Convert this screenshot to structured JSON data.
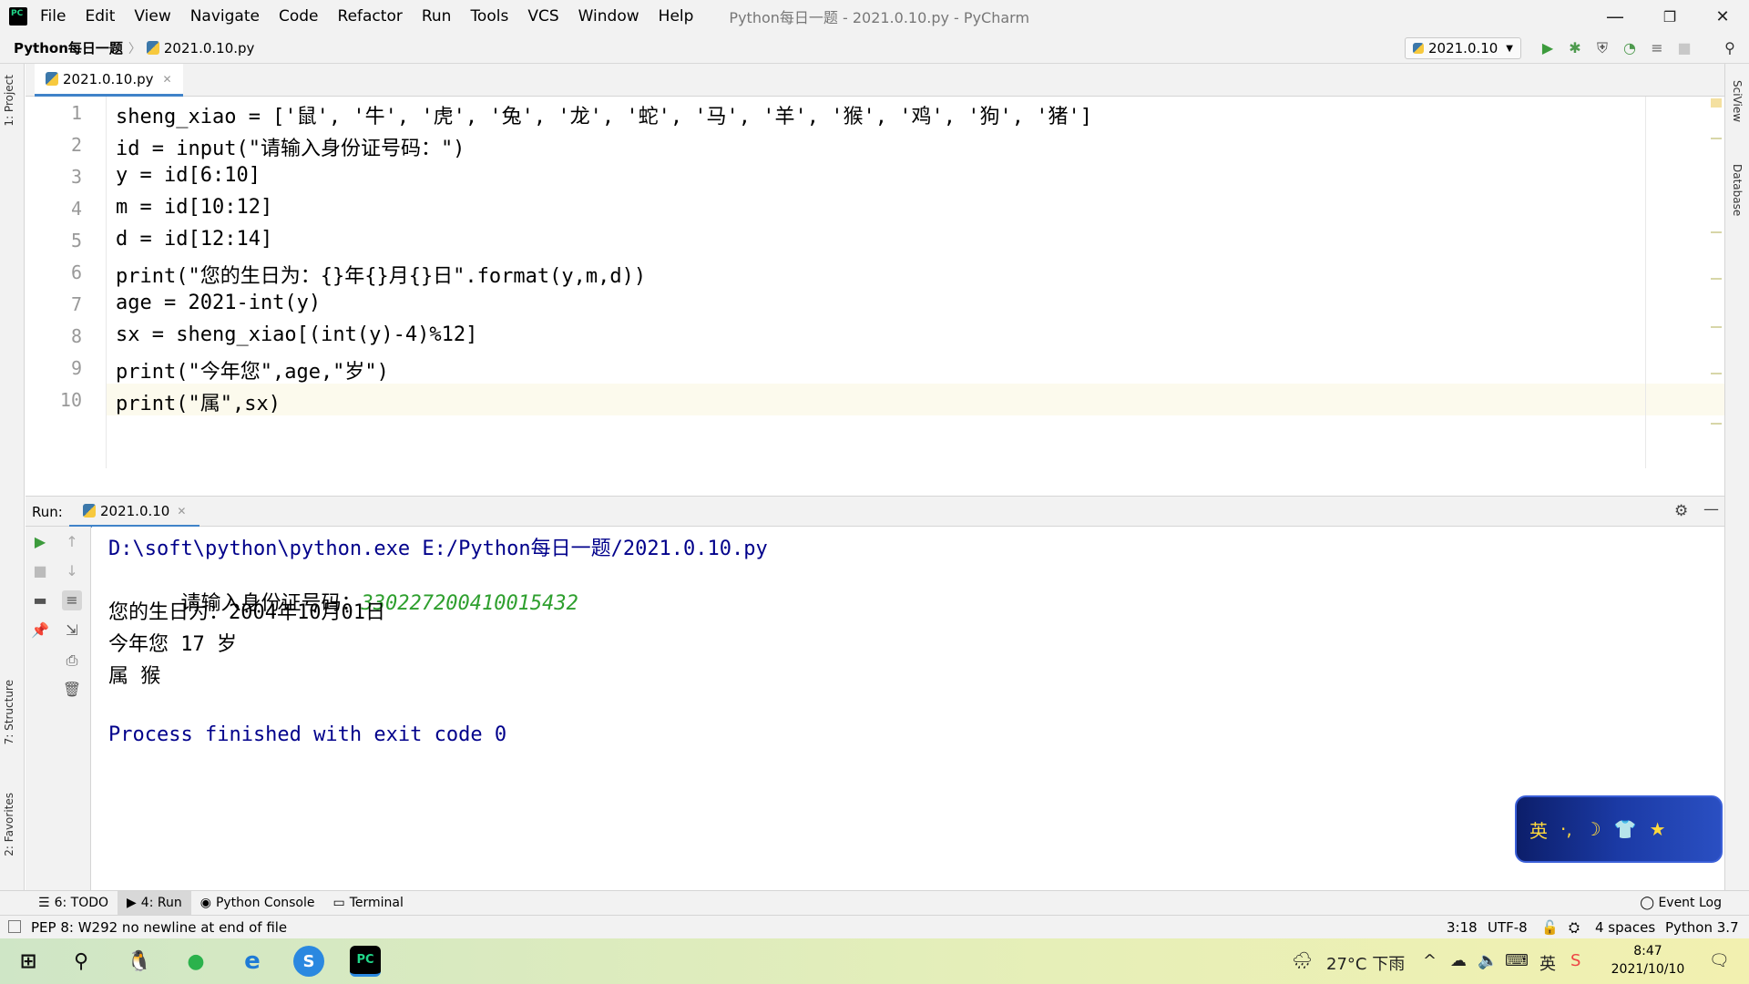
{
  "titlebar": {
    "menu": [
      "File",
      "Edit",
      "View",
      "Navigate",
      "Code",
      "Refactor",
      "Run",
      "Tools",
      "VCS",
      "Window",
      "Help"
    ],
    "title": "Python每日一题 - 2021.0.10.py - PyCharm",
    "minimize": "—",
    "restore": "❐",
    "close": "✕"
  },
  "navbar": {
    "project": "Python每日一题",
    "file": "2021.0.10.py",
    "run_config": "2021.0.10"
  },
  "sidebars": {
    "left": [
      "1: Project",
      "7: Structure",
      "2: Favorites"
    ],
    "right": [
      "SciView",
      "Database"
    ]
  },
  "editor": {
    "tab": "2021.0.10.py",
    "line_numbers": [
      "1",
      "2",
      "3",
      "4",
      "5",
      "6",
      "7",
      "8",
      "9",
      "10"
    ],
    "lines": [
      "sheng_xiao = ['鼠', '牛', '虎', '兔', '龙', '蛇', '马', '羊', '猴', '鸡', '狗', '猪']",
      "id = input(\"请输入身份证号码：\")",
      "y = id[6:10]",
      "m = id[10:12]",
      "d = id[12:14]",
      "print(\"您的生日为：{}年{}月{}日\".format(y,m,d))",
      "age = 2021-int(y)",
      "sx = sheng_xiao[(int(y)-4)%12]",
      "print(\"今年您\",age,\"岁\")",
      "print(\"属\",sx)"
    ]
  },
  "run": {
    "label": "Run:",
    "tab": "2021.0.10",
    "output": {
      "cmd": "D:\\soft\\python\\python.exe E:/Python每日一题/2021.0.10.py",
      "prompt": "请输入身份证号码：",
      "input": "330227200410015432",
      "birthday": "您的生日为：2004年10月01日",
      "age": "今年您 17 岁",
      "zodiac": "属 猴",
      "exit": "Process finished with exit code 0"
    }
  },
  "ime": {
    "label": "英"
  },
  "bottom_tabs": [
    "6: TODO",
    "4: Run",
    "Python Console",
    "Terminal"
  ],
  "event_log": "Event Log",
  "status": {
    "message": "PEP 8: W292 no newline at end of file",
    "position": "3:18",
    "encoding": "UTF-8",
    "indent": "4 spaces",
    "interpreter": "Python 3.7"
  },
  "taskbar": {
    "weather": "27°C 下雨",
    "ime": "英",
    "time": "8:47",
    "date": "2021/10/10"
  }
}
